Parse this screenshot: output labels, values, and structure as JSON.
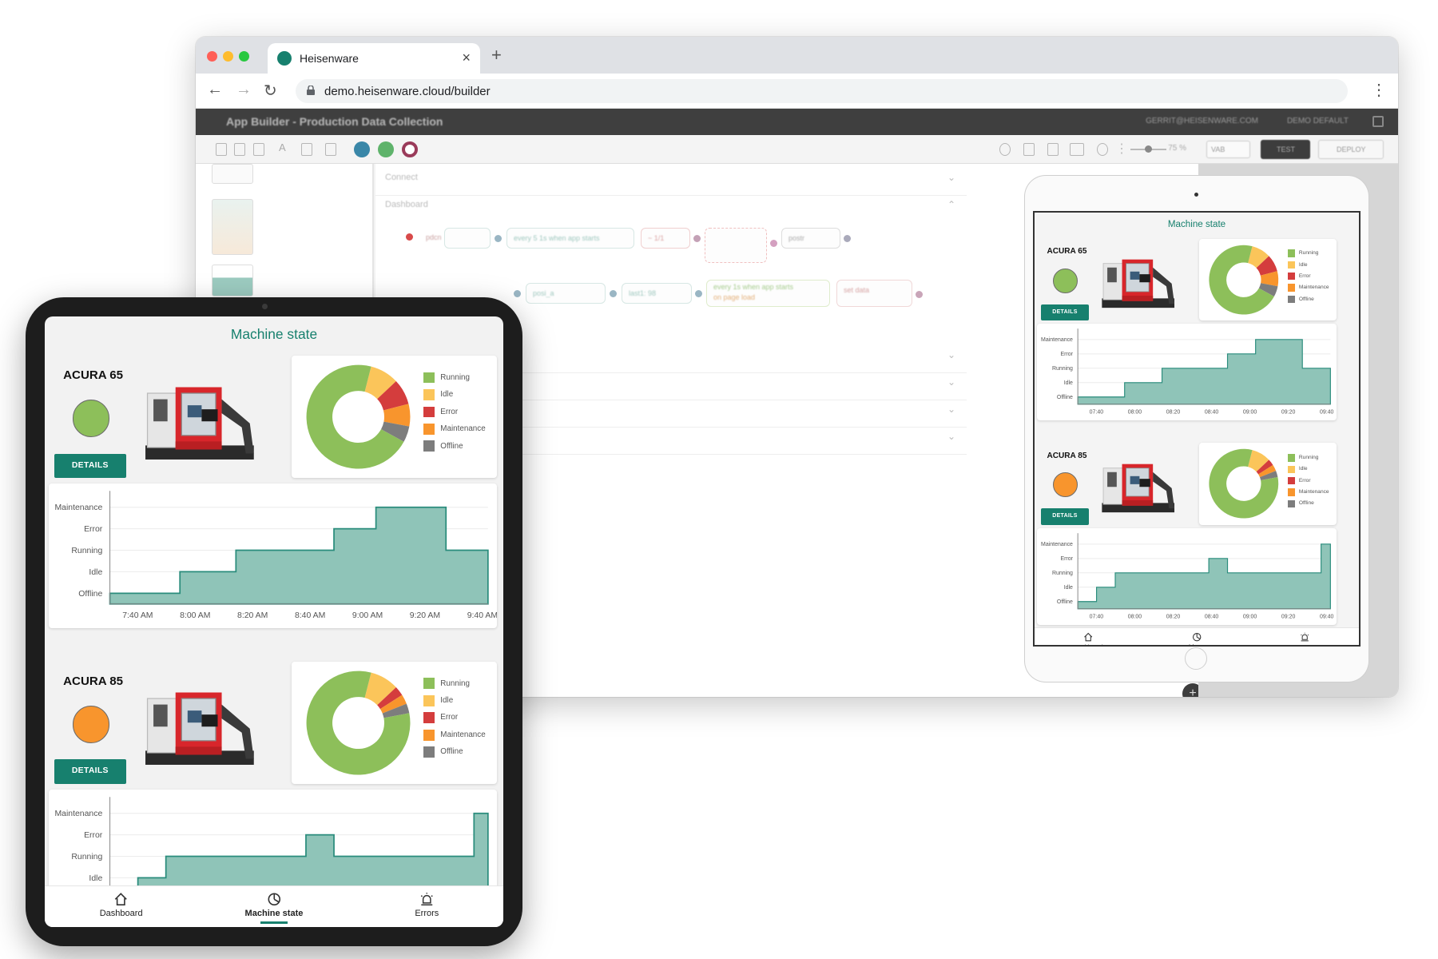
{
  "browser": {
    "tab_title": "Heisenware",
    "url": "demo.heisenware.cloud/builder",
    "tab_close": "×",
    "new_tab": "+"
  },
  "builder": {
    "title": "App Builder - Production Data Collection",
    "user": "GERRIT@HEISENWARE.COM",
    "org": "DEMO DEFAULT",
    "zoom": "75 %",
    "resolution": "VAB",
    "test_label": "TEST",
    "deploy_label": "DEPLOY",
    "sections": [
      {
        "label": "Connect"
      },
      {
        "label": "Dashboard"
      }
    ],
    "nodes": [
      "pdcn",
      "every 5 1s when app starts",
      "~ 1/1",
      "postr",
      "posi_a",
      "last1: 98",
      "every 1s when app starts",
      "on page load",
      "set data"
    ],
    "add_button": "+"
  },
  "app": {
    "screen_title": "Machine state",
    "machines": [
      {
        "name": "ACURA 65",
        "status_color": "#8dbf5a",
        "details_label": "DETAILS",
        "donut": [
          {
            "label": "Running",
            "value": 71,
            "color": "#8dbf5a"
          },
          {
            "label": "Idle",
            "value": 9,
            "color": "#fbc55a"
          },
          {
            "label": "Error",
            "value": 8,
            "color": "#d43d3d"
          },
          {
            "label": "Maintenance",
            "value": 7,
            "color": "#f8952d"
          },
          {
            "label": "Offline",
            "value": 5,
            "color": "#7d7d7d"
          }
        ],
        "timeline": {
          "y_levels": [
            "Offline",
            "Idle",
            "Running",
            "Error",
            "Maintenance"
          ],
          "x_ticks": [
            "7:40 AM",
            "8:00 AM",
            "8:20 AM",
            "8:40 AM",
            "9:00 AM",
            "9:20 AM",
            "9:40 AM"
          ],
          "x_ticks_small": [
            "07:40",
            "08:00",
            "08:20",
            "08:40",
            "09:00",
            "09:20",
            "09:40"
          ],
          "x_range": [
            0,
            135
          ],
          "steps": [
            [
              0,
              0
            ],
            [
              25,
              1
            ],
            [
              45,
              2
            ],
            [
              80,
              3
            ],
            [
              95,
              4
            ],
            [
              120,
              2
            ],
            [
              135,
              2
            ]
          ]
        }
      },
      {
        "name": "ACURA 85",
        "status_color": "#f8952d",
        "details_label": "DETAILS",
        "donut": [
          {
            "label": "Running",
            "value": 82,
            "color": "#8dbf5a"
          },
          {
            "label": "Idle",
            "value": 9,
            "color": "#fbc55a"
          },
          {
            "label": "Error",
            "value": 3,
            "color": "#d43d3d"
          },
          {
            "label": "Maintenance",
            "value": 3,
            "color": "#f8952d"
          },
          {
            "label": "Offline",
            "value": 3,
            "color": "#7d7d7d"
          }
        ],
        "timeline": {
          "y_levels": [
            "Offline",
            "Idle",
            "Running",
            "Error",
            "Maintenance"
          ],
          "x_ticks": [
            "7:40 AM",
            "8:00 AM",
            "8:20 AM",
            "8:40 AM",
            "9:00 AM",
            "9:20 AM",
            "9:40 AM"
          ],
          "x_ticks_small": [
            "07:40",
            "08:00",
            "08:20",
            "08:40",
            "09:00",
            "09:20",
            "09:40"
          ],
          "x_range": [
            0,
            135
          ],
          "steps": [
            [
              0,
              0
            ],
            [
              10,
              1
            ],
            [
              20,
              2
            ],
            [
              70,
              3
            ],
            [
              80,
              2
            ],
            [
              130,
              4
            ],
            [
              135,
              4
            ]
          ]
        }
      }
    ],
    "nav": [
      {
        "label": "Dashboard",
        "icon": "home-icon"
      },
      {
        "label": "Machine state",
        "icon": "pie-chart-icon"
      },
      {
        "label": "Errors",
        "icon": "alarm-icon"
      }
    ],
    "colors": {
      "accent": "#17806e",
      "chart_fill": "#8fc4b8",
      "chart_line": "#2a8c7c"
    }
  }
}
